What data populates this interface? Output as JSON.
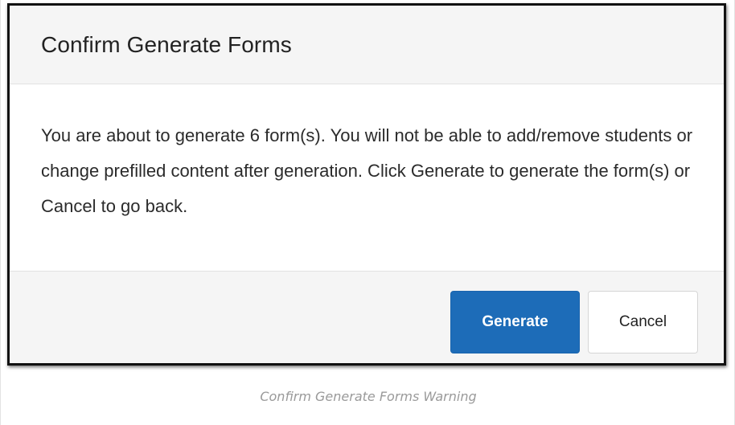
{
  "dialog": {
    "title": "Confirm Generate Forms",
    "message": "You are about to generate 6 form(s). You will not be able to add/remove students or change prefilled content after generation. Click Generate to generate the form(s) or Cancel to go back.",
    "generate_label": "Generate",
    "cancel_label": "Cancel"
  },
  "caption": "Confirm Generate Forms Warning",
  "colors": {
    "primary": "#1d6cb8",
    "header_bg": "#f5f5f5",
    "border": "#111111"
  }
}
